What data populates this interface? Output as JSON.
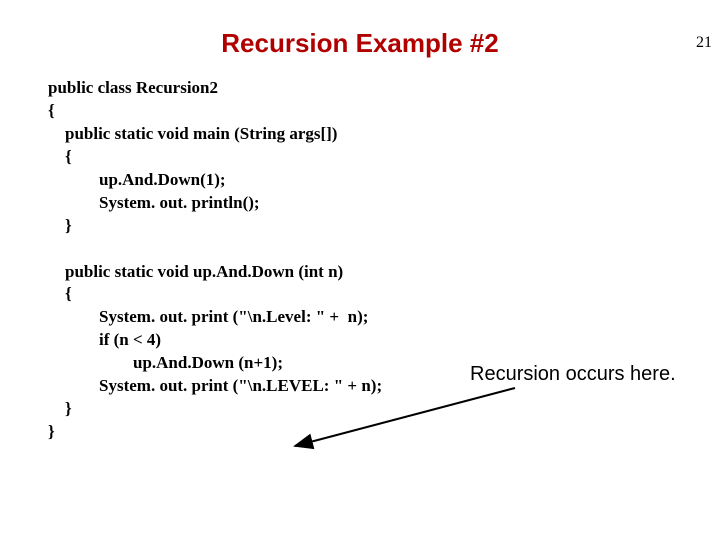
{
  "page_number": "21",
  "title": "Recursion Example #2",
  "code": {
    "l1": "public class Recursion2",
    "l2": "{",
    "l3": "    public static void main (String args[])",
    "l4": "    {",
    "l5": "            up.And.Down(1);",
    "l6": "            System. out. println();",
    "l7": "    }",
    "l8": "",
    "l9": "    public static void up.And.Down (int n)",
    "l10": "    {",
    "l11": "            System. out. print (\"\\n.Level: \" +  n);",
    "l12": "            if (n < 4)",
    "l13": "                    up.And.Down (n+1);",
    "l14": "            System. out. print (\"\\n.LEVEL: \" + n);",
    "l15": "    }",
    "l16": "}"
  },
  "annotation": "Recursion occurs here."
}
